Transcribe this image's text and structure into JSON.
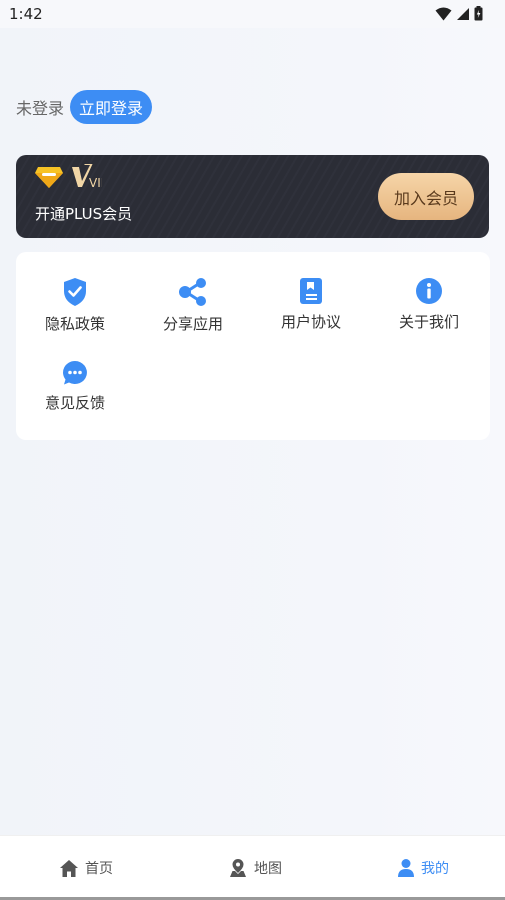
{
  "status_bar": {
    "time": "1:42"
  },
  "login": {
    "status_text": "未登录",
    "button_label": "立即登录"
  },
  "vip": {
    "badge_text": "VIP",
    "title": "开通PLUS会员",
    "join_label": "加入会员"
  },
  "menu": {
    "items": [
      {
        "label": "隐私政策",
        "icon": "shield-check-icon"
      },
      {
        "label": "分享应用",
        "icon": "share-icon"
      },
      {
        "label": "用户协议",
        "icon": "document-icon"
      },
      {
        "label": "关于我们",
        "icon": "info-icon"
      },
      {
        "label": "意见反馈",
        "icon": "chat-bubble-icon"
      }
    ]
  },
  "bottom_nav": {
    "items": [
      {
        "label": "首页",
        "icon": "home-icon",
        "active": false
      },
      {
        "label": "地图",
        "icon": "map-pin-icon",
        "active": false
      },
      {
        "label": "我的",
        "icon": "user-icon",
        "active": true
      }
    ]
  },
  "colors": {
    "accent": "#3d8df4",
    "vip_gold": "#e8bb85",
    "card_dark": "#2b2d36",
    "inactive_nav": "#666666"
  }
}
